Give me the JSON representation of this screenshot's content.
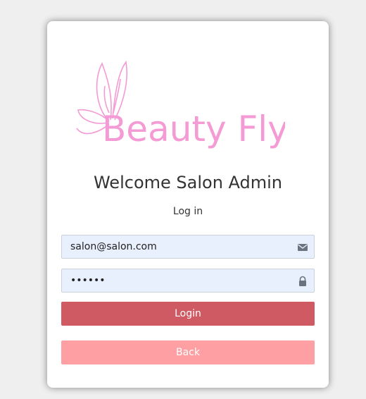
{
  "brand": {
    "logo_text": "Beauty Fly",
    "logo_color": "#f49ad4"
  },
  "header": {
    "title": "Welcome Salon Admin",
    "subtitle": "Log in"
  },
  "form": {
    "email": {
      "value": "salon@salon.com",
      "icon": "envelope-icon"
    },
    "password": {
      "value": "••••••",
      "icon": "lock-icon"
    }
  },
  "buttons": {
    "login_label": "Login",
    "back_label": "Back",
    "login_color": "#d05a64",
    "back_color": "#fd9fa3"
  }
}
